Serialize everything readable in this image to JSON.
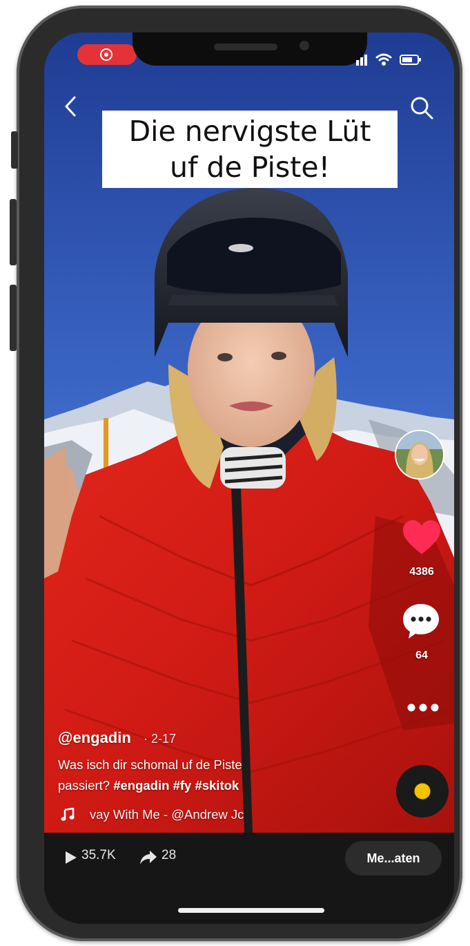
{
  "overlay": {
    "caption_line1": "Die nervigste Lüt",
    "caption_line2": "uf de Piste!"
  },
  "side_rail": {
    "likes": "4386",
    "comments": "64"
  },
  "post": {
    "username": "@engadin",
    "date": "· 2-17",
    "description_line1": "Was isch dir schomal uf de Piste",
    "description_prefix": "passiert?",
    "hashtags": "#engadin #fy #skitok",
    "music": "vay With Me - @Andrew Jc"
  },
  "bottom_bar": {
    "plays": "35.7K",
    "shares": "28",
    "action_label": "Me...aten"
  },
  "icons": [
    "record-icon",
    "signal-icon",
    "wifi-icon",
    "battery-icon",
    "back-icon",
    "search-icon",
    "heart-icon",
    "comment-icon",
    "more-icon",
    "music-note-icon",
    "play-icon",
    "share-icon"
  ],
  "colors": {
    "like_red": "#fe2c55",
    "record_red": "#e53238",
    "disc_yellow": "#f0c400",
    "bar_bg": "#161616"
  }
}
